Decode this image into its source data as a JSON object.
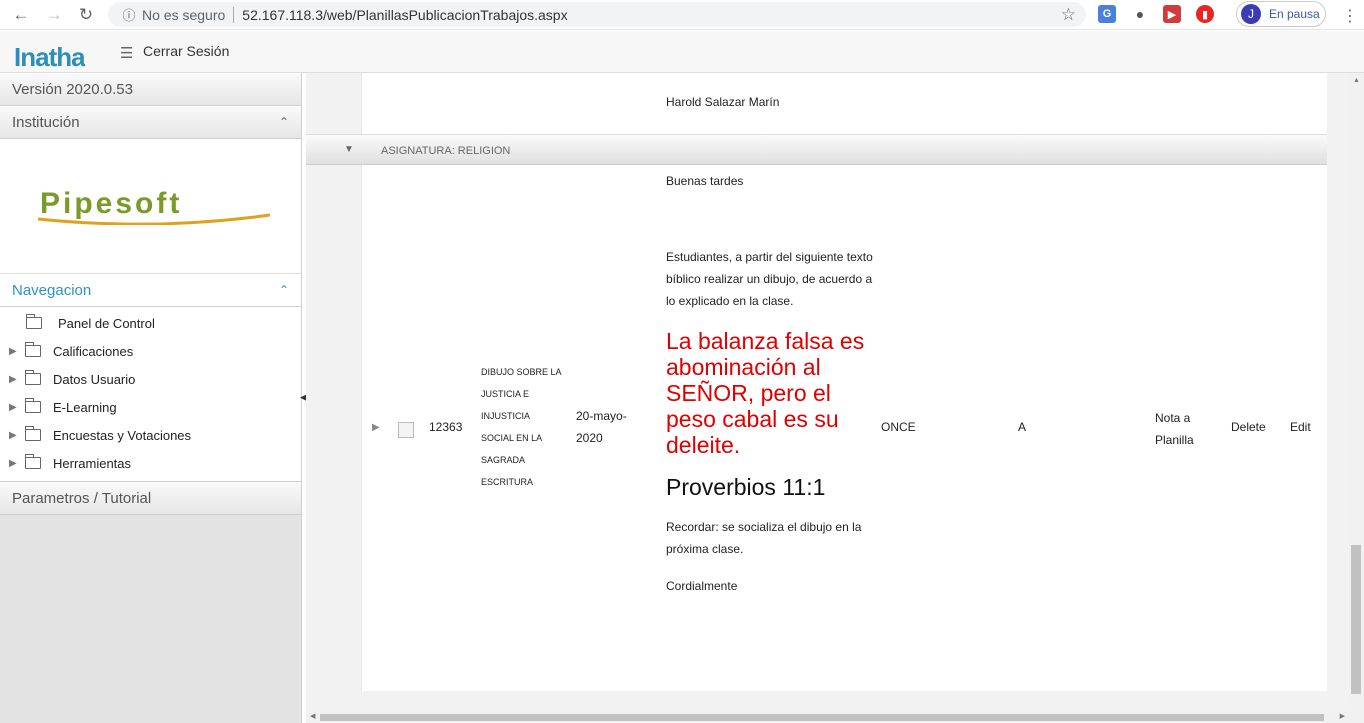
{
  "browser": {
    "security_label": "No es seguro",
    "url": "52.167.118.3/web/PlanillasPublicacionTrabajos.aspx",
    "profile_initial": "J",
    "profile_status": "En pausa"
  },
  "header": {
    "logo": "Inatha",
    "logout_label": "Cerrar Sesión"
  },
  "sidebar": {
    "version": "Versión 2020.0.53",
    "institution_title": "Institución",
    "institution_logo": "Pipesoft",
    "navigation_title": "Navegacion",
    "items": [
      {
        "label": "Panel de Control",
        "expandable": false
      },
      {
        "label": "Calificaciones",
        "expandable": true
      },
      {
        "label": "Datos Usuario",
        "expandable": true
      },
      {
        "label": "E-Learning",
        "expandable": true
      },
      {
        "label": "Encuestas y Votaciones",
        "expandable": true
      },
      {
        "label": "Herramientas",
        "expandable": true
      }
    ],
    "params_title": "Parametros / Tutorial"
  },
  "main": {
    "teacher": "Harold Salazar Marín",
    "group_label": "ASIGNATURA: RELIGION",
    "row": {
      "code": "12363",
      "title": "DIBUJO SOBRE LA JUSTICIA E INJUSTICIA SOCIAL EN LA SAGRADA ESCRITURA",
      "date": "20-mayo-2020",
      "greeting": "Buenas tardes",
      "instructions": "Estudiantes, a partir del siguiente texto bíblico realizar un dibujo, de acuerdo a lo explicado en la clase.",
      "verse": "La balanza falsa es abominación al SEÑOR, pero el peso cabal es su deleite.",
      "reference": "Proverbios 11:1",
      "reminder": "Recordar: se socializa el dibujo en la próxima clase.",
      "closing": "Cordialmente",
      "grade": "ONCE",
      "section": "A",
      "nota_link": "Nota a Planilla",
      "delete_link": "Delete",
      "edit_link": "Edit"
    }
  },
  "colors": {
    "accent": "#2b93c7",
    "verse": "#e00000"
  }
}
